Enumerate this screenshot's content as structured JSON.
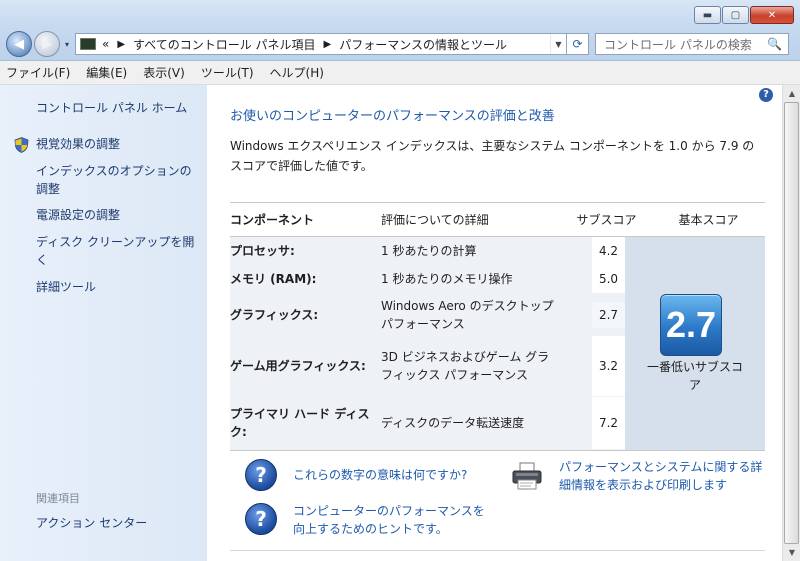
{
  "window": {
    "minimize": "▬",
    "maximize": "▢",
    "close": "✕"
  },
  "nav": {
    "back": "◀",
    "forward": "▶",
    "dropdown": "▾",
    "breadcrumb_chevron": "«",
    "breadcrumb": [
      "すべてのコントロール パネル項目",
      "パフォーマンスの情報とツール"
    ],
    "breadcrumb_sep": "▶",
    "address_dropdown": "▼",
    "refresh_icon": "⟳",
    "search_placeholder": "コントロール パネルの検索",
    "search_icon": "🔍"
  },
  "menu": [
    "ファイル(F)",
    "編集(E)",
    "表示(V)",
    "ツール(T)",
    "ヘルプ(H)"
  ],
  "sidebar": {
    "home": "コントロール パネル ホーム",
    "links": [
      "視覚効果の調整",
      "インデックスのオプションの調整",
      "電源設定の調整",
      "ディスク クリーンアップを開く",
      "詳細ツール"
    ],
    "related_heading": "関連項目",
    "related_links": [
      "アクション センター"
    ]
  },
  "main": {
    "help_icon": "?",
    "heading": "お使いのコンピューターのパフォーマンスの評価と改善",
    "description": "Windows エクスペリエンス インデックスは、主要なシステム コンポーネントを 1.0 から 7.9 の スコアで評価した値です。",
    "table_headers": [
      "コンポーネント",
      "評価についての詳細",
      "サブスコア",
      "基本スコア"
    ],
    "rows": [
      {
        "component": "プロセッサ:",
        "detail": "1 秒あたりの計算",
        "subscore": "4.2"
      },
      {
        "component": "メモリ (RAM):",
        "detail": "1 秒あたりのメモリ操作",
        "subscore": "5.0"
      },
      {
        "component": "グラフィックス:",
        "detail": "Windows Aero のデスクトップ パフォーマンス",
        "subscore": "2.7"
      },
      {
        "component": "ゲーム用グラフィックス:",
        "detail": "3D ビジネスおよびゲーム グラフィックス パフォーマンス",
        "subscore": "3.2"
      },
      {
        "component": "プライマリ ハード ディスク:",
        "detail": "ディスクのデータ転送速度",
        "subscore": "7.2"
      }
    ],
    "base_score": "2.7",
    "base_score_label": "一番低いサブスコア",
    "help_links": [
      {
        "icon": "?",
        "text": "これらの数字の意味は何ですか?"
      },
      {
        "icon": "?",
        "text": "コンピューターのパフォーマンスを向上するためのヒントです。"
      }
    ],
    "print_link": "パフォーマンスとシステムに関する詳細情報を表示および印刷します"
  },
  "colors": {
    "link": "#1e5aab",
    "sidebar_bg": "#e8f0fa",
    "score_badge": "#2c78c8"
  }
}
